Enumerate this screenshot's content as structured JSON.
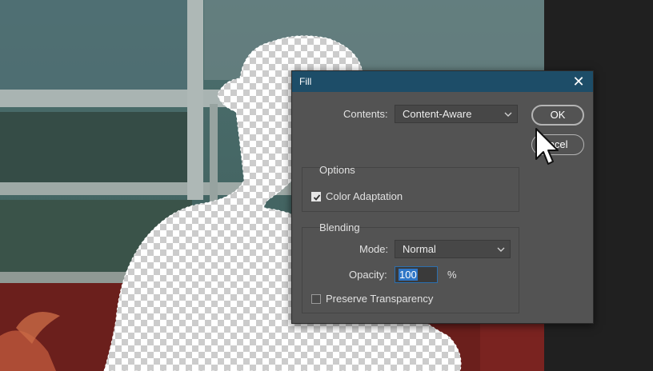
{
  "dialog": {
    "title": "Fill",
    "close_glyph": "✕",
    "contents": {
      "label": "Contents:",
      "value": "Content-Aware"
    },
    "options": {
      "title": "Options",
      "color_adaptation": {
        "label": "Color Adaptation",
        "checked": true
      }
    },
    "blending": {
      "title": "Blending",
      "mode": {
        "label": "Mode:",
        "value": "Normal"
      },
      "opacity": {
        "label": "Opacity:",
        "value": "100",
        "unit": "%"
      },
      "preserve_transparency": {
        "label": "Preserve Transparency",
        "checked": false
      }
    },
    "buttons": {
      "ok": "OK",
      "cancel": "Cancel"
    }
  },
  "colors": {
    "titlebar": "#1d4d68",
    "dialog_bg": "#535353",
    "selection_highlight": "#2f76c7"
  },
  "icons": {
    "close": "close-icon",
    "dropdown": "chevron-down-icon",
    "checkbox": "checkmark-icon",
    "pointer": "mouse-pointer-icon"
  }
}
